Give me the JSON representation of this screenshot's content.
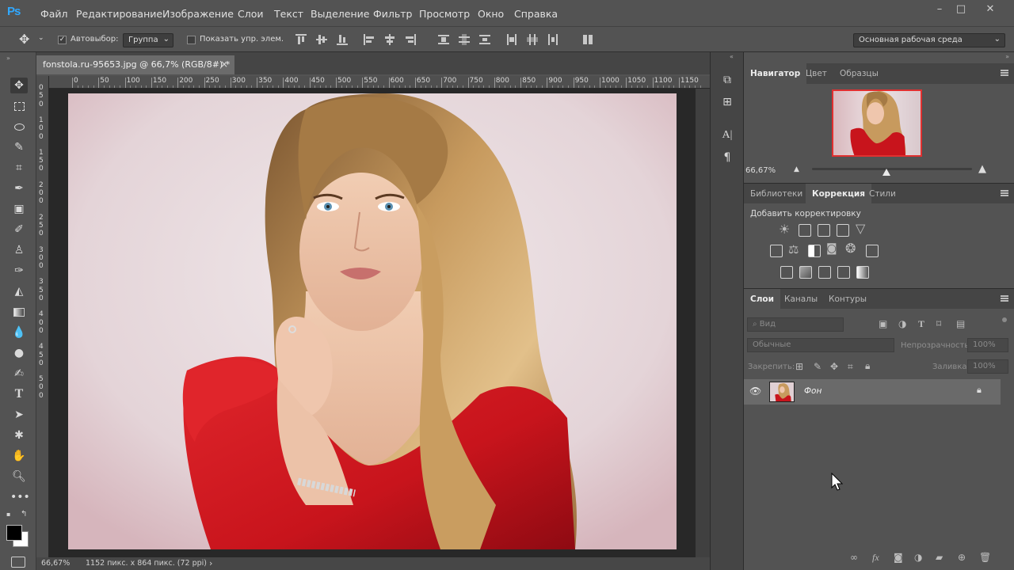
{
  "app": {
    "logo": "Ps"
  },
  "menu": [
    "Файл",
    "Редактирование",
    "Изображение",
    "Слои",
    "Текст",
    "Выделение",
    "Фильтр",
    "Просмотр",
    "Окно",
    "Справка"
  ],
  "window_controls": [
    "–",
    "□",
    "✕"
  ],
  "options": {
    "autoselect_label": "Автовыбор:",
    "autoselect_value": "Группа",
    "show_transform_label": "Показать упр. элем.",
    "workspace": "Основная рабочая среда"
  },
  "document": {
    "tab_title": "fonstola.ru-95653.jpg @ 66,7% (RGB/8#) *",
    "close": "×",
    "ruler_h": [
      "0",
      "50",
      "100",
      "150",
      "200",
      "250",
      "300",
      "350",
      "400",
      "450",
      "500",
      "550",
      "600",
      "650",
      "700",
      "750",
      "800",
      "850",
      "900",
      "950",
      "1000",
      "1050",
      "1100",
      "1150"
    ],
    "ruler_v": [
      "0",
      "5",
      "0",
      "1",
      "0",
      "0",
      "1",
      "5",
      "0",
      "2",
      "0",
      "0",
      "2",
      "5",
      "0",
      "3",
      "0",
      "0",
      "3",
      "5",
      "0",
      "4",
      "0",
      "0",
      "4",
      "5",
      "0",
      "5",
      "0",
      "0"
    ]
  },
  "status": {
    "zoom": "66,67%",
    "info": "1152 пикс. x 864 пикс. (72 ppi)",
    "arrow": "›"
  },
  "navigator": {
    "tabs": [
      "Навигатор",
      "Цвет",
      "Образцы"
    ],
    "zoom": "66,67%"
  },
  "correction": {
    "tabs": [
      "Библиотеки",
      "Коррекция",
      "Стили"
    ],
    "title": "Добавить корректировку"
  },
  "layers": {
    "tabs": [
      "Слои",
      "Каналы",
      "Контуры"
    ],
    "search_placeholder": "Вид",
    "blend_mode": "Обычные",
    "opacity_label": "Непрозрачность:",
    "opacity_value": "100%",
    "lock_label": "Закрепить:",
    "fill_label": "Заливка:",
    "fill_value": "100%",
    "layer_name": "Фон"
  },
  "colors": {
    "accent": "#31a8ff",
    "panel_bg": "#535353",
    "dark_bg": "#282828",
    "dress_red": "#c8141c"
  }
}
